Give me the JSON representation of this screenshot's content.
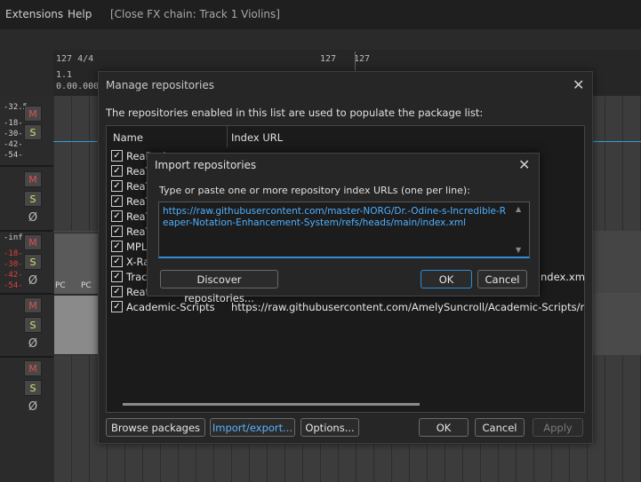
{
  "menubar": {
    "items": [
      "Extensions",
      "Help"
    ],
    "window_caption": "[Close FX chain: Track 1 Violins]"
  },
  "ruler": {
    "bar_start": "127 4/4",
    "time_sig": "1.1",
    "time": "0.00.000",
    "marker_left": "127",
    "marker_right": "127"
  },
  "tracks": {
    "meters": [
      {
        "top": "-32.5",
        "vals": [
          "-18-",
          "-30-",
          "-42-",
          "-54-"
        ],
        "peak_red": false
      },
      {
        "top": "-inf",
        "vals": [
          "-18-",
          "-30-",
          "-42-",
          "-54-"
        ],
        "peak_red": true
      }
    ],
    "mute_label": "M",
    "solo_label": "S",
    "phase_label": "Ø",
    "pc_label": "PC"
  },
  "manage_dialog": {
    "title": "Manage repositories",
    "description": "The repositories enabled in this list are used to populate the package list:",
    "columns": {
      "name": "Name",
      "url": "Index URL"
    },
    "rows": [
      {
        "name": "ReaPack",
        "url": "",
        "checked": true
      },
      {
        "name": "ReaTeam Extensions",
        "url": "",
        "checked": true
      },
      {
        "name": "ReaTeam JSFX",
        "url": "",
        "checked": true
      },
      {
        "name": "ReaTeam LangPacks",
        "url": "",
        "checked": true
      },
      {
        "name": "ReaTeam Scripts",
        "url": "",
        "checked": true
      },
      {
        "name": "ReaTeam Themes",
        "url": "",
        "checked": true
      },
      {
        "name": "MPL Scripts",
        "url": "",
        "checked": true
      },
      {
        "name": "X-Raym Scripts",
        "url": "",
        "checked": true
      },
      {
        "name": "Tracktion",
        "url": "ndex.xml",
        "checked": true
      },
      {
        "name": "Reatio",
        "url": "",
        "checked": true
      },
      {
        "name": "Academic-Scripts",
        "url": "https://raw.githubusercontent.com/AmelySuncroll/Academic-Scripts/master/index.x",
        "checked": true
      }
    ],
    "buttons": {
      "browse": "Browse packages",
      "import_export": "Import/export...",
      "options": "Options...",
      "ok": "OK",
      "cancel": "Cancel",
      "apply": "Apply"
    }
  },
  "import_dialog": {
    "title": "Import repositories",
    "description": "Type or paste one or more repository index URLs (one per line):",
    "input_value": "https://raw.githubusercontent.com/master-NORG/Dr.-Odine-s-Incredible-Reaper-Notation-Enhancement-System/refs/heads/main/index.xml",
    "buttons": {
      "discover": "Discover repositories...",
      "ok": "OK",
      "cancel": "Cancel"
    }
  },
  "colors": {
    "accent": "#2f8ed6",
    "link_text": "#4fb0ff",
    "mute_red": "#e05050",
    "solo_yellow": "#e0e070"
  }
}
